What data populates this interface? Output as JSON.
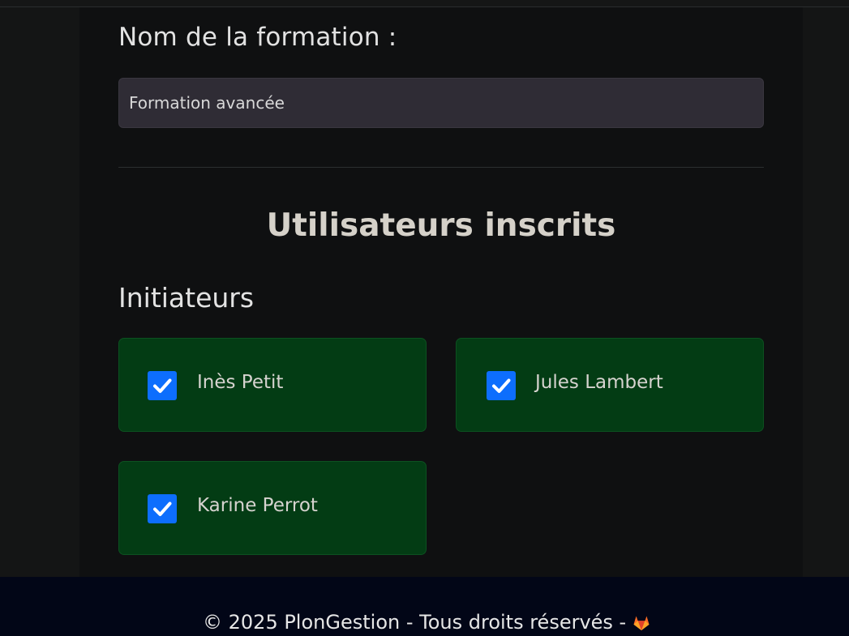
{
  "form": {
    "label": "Nom de la formation :",
    "value": "Formation avancée",
    "placeholder": ""
  },
  "section": {
    "title": "Utilisateurs inscrits"
  },
  "group": {
    "title": "Initiateurs",
    "users": [
      {
        "name": "Inès Petit",
        "checked": true
      },
      {
        "name": "Jules Lambert",
        "checked": true
      },
      {
        "name": "Karine Perrot",
        "checked": true
      }
    ]
  },
  "footer": {
    "text": "© 2025 PlonGestion - Tous droits réservés -",
    "icon": "gitlab-icon"
  },
  "colors": {
    "card_bg": "#033c14",
    "checkbox": "#0d6efd",
    "footer_bg": "#020617",
    "input_bg": "#2f2c35",
    "gitlab_orange": "#fc6d26"
  }
}
